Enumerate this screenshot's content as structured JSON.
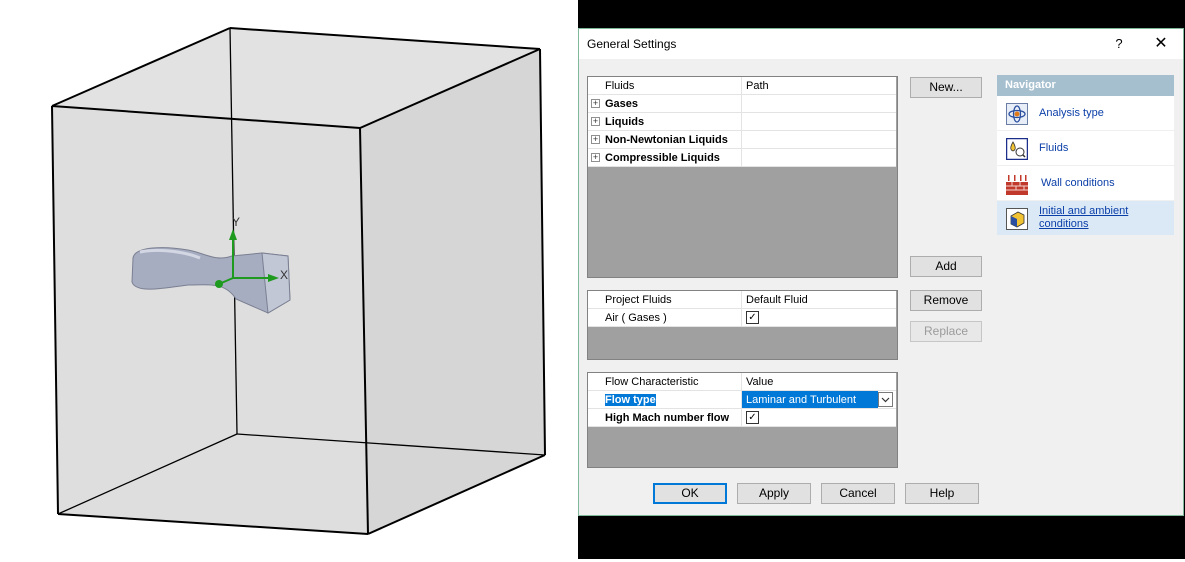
{
  "viewport": {
    "axis_y_label": "Y",
    "axis_x_label": "X"
  },
  "dialog": {
    "title": "General Settings",
    "help_glyph": "?",
    "close_glyph": "✕"
  },
  "fluids_grid": {
    "headers": [
      "Fluids",
      "Path"
    ],
    "rows": [
      {
        "label": "Gases",
        "expander": "+"
      },
      {
        "label": "Liquids",
        "expander": "+"
      },
      {
        "label": "Non-Newtonian Liquids",
        "expander": "+"
      },
      {
        "label": "Compressible Liquids",
        "expander": "+"
      }
    ]
  },
  "project_fluids_grid": {
    "headers": [
      "Project Fluids",
      "Default Fluid"
    ],
    "rows": [
      {
        "label": "Air ( Gases )",
        "default_checked": true
      }
    ]
  },
  "flow_grid": {
    "headers": [
      "Flow Characteristic",
      "Value"
    ],
    "rows": [
      {
        "label": "Flow type",
        "value": "Laminar and Turbulent",
        "selected": true
      },
      {
        "label": "High Mach number flow",
        "checked": true
      }
    ]
  },
  "buttons": {
    "new": "New...",
    "add": "Add",
    "remove": "Remove",
    "replace": "Replace",
    "ok": "OK",
    "apply": "Apply",
    "cancel": "Cancel",
    "help": "Help"
  },
  "navigator": {
    "header": "Navigator",
    "items": [
      {
        "label": "Analysis type",
        "icon": "analysis-type-icon"
      },
      {
        "label": "Fluids",
        "icon": "fluids-icon"
      },
      {
        "label": "Wall conditions",
        "icon": "wall-conditions-icon"
      },
      {
        "label": "Initial and ambient conditions",
        "icon": "initial-conditions-icon",
        "selected": true
      }
    ]
  },
  "colors": {
    "selection": "#0078d7",
    "navigator_header": "#a6bfcf",
    "link": "#0b3fa8",
    "dialog_border": "#7fb89a"
  }
}
